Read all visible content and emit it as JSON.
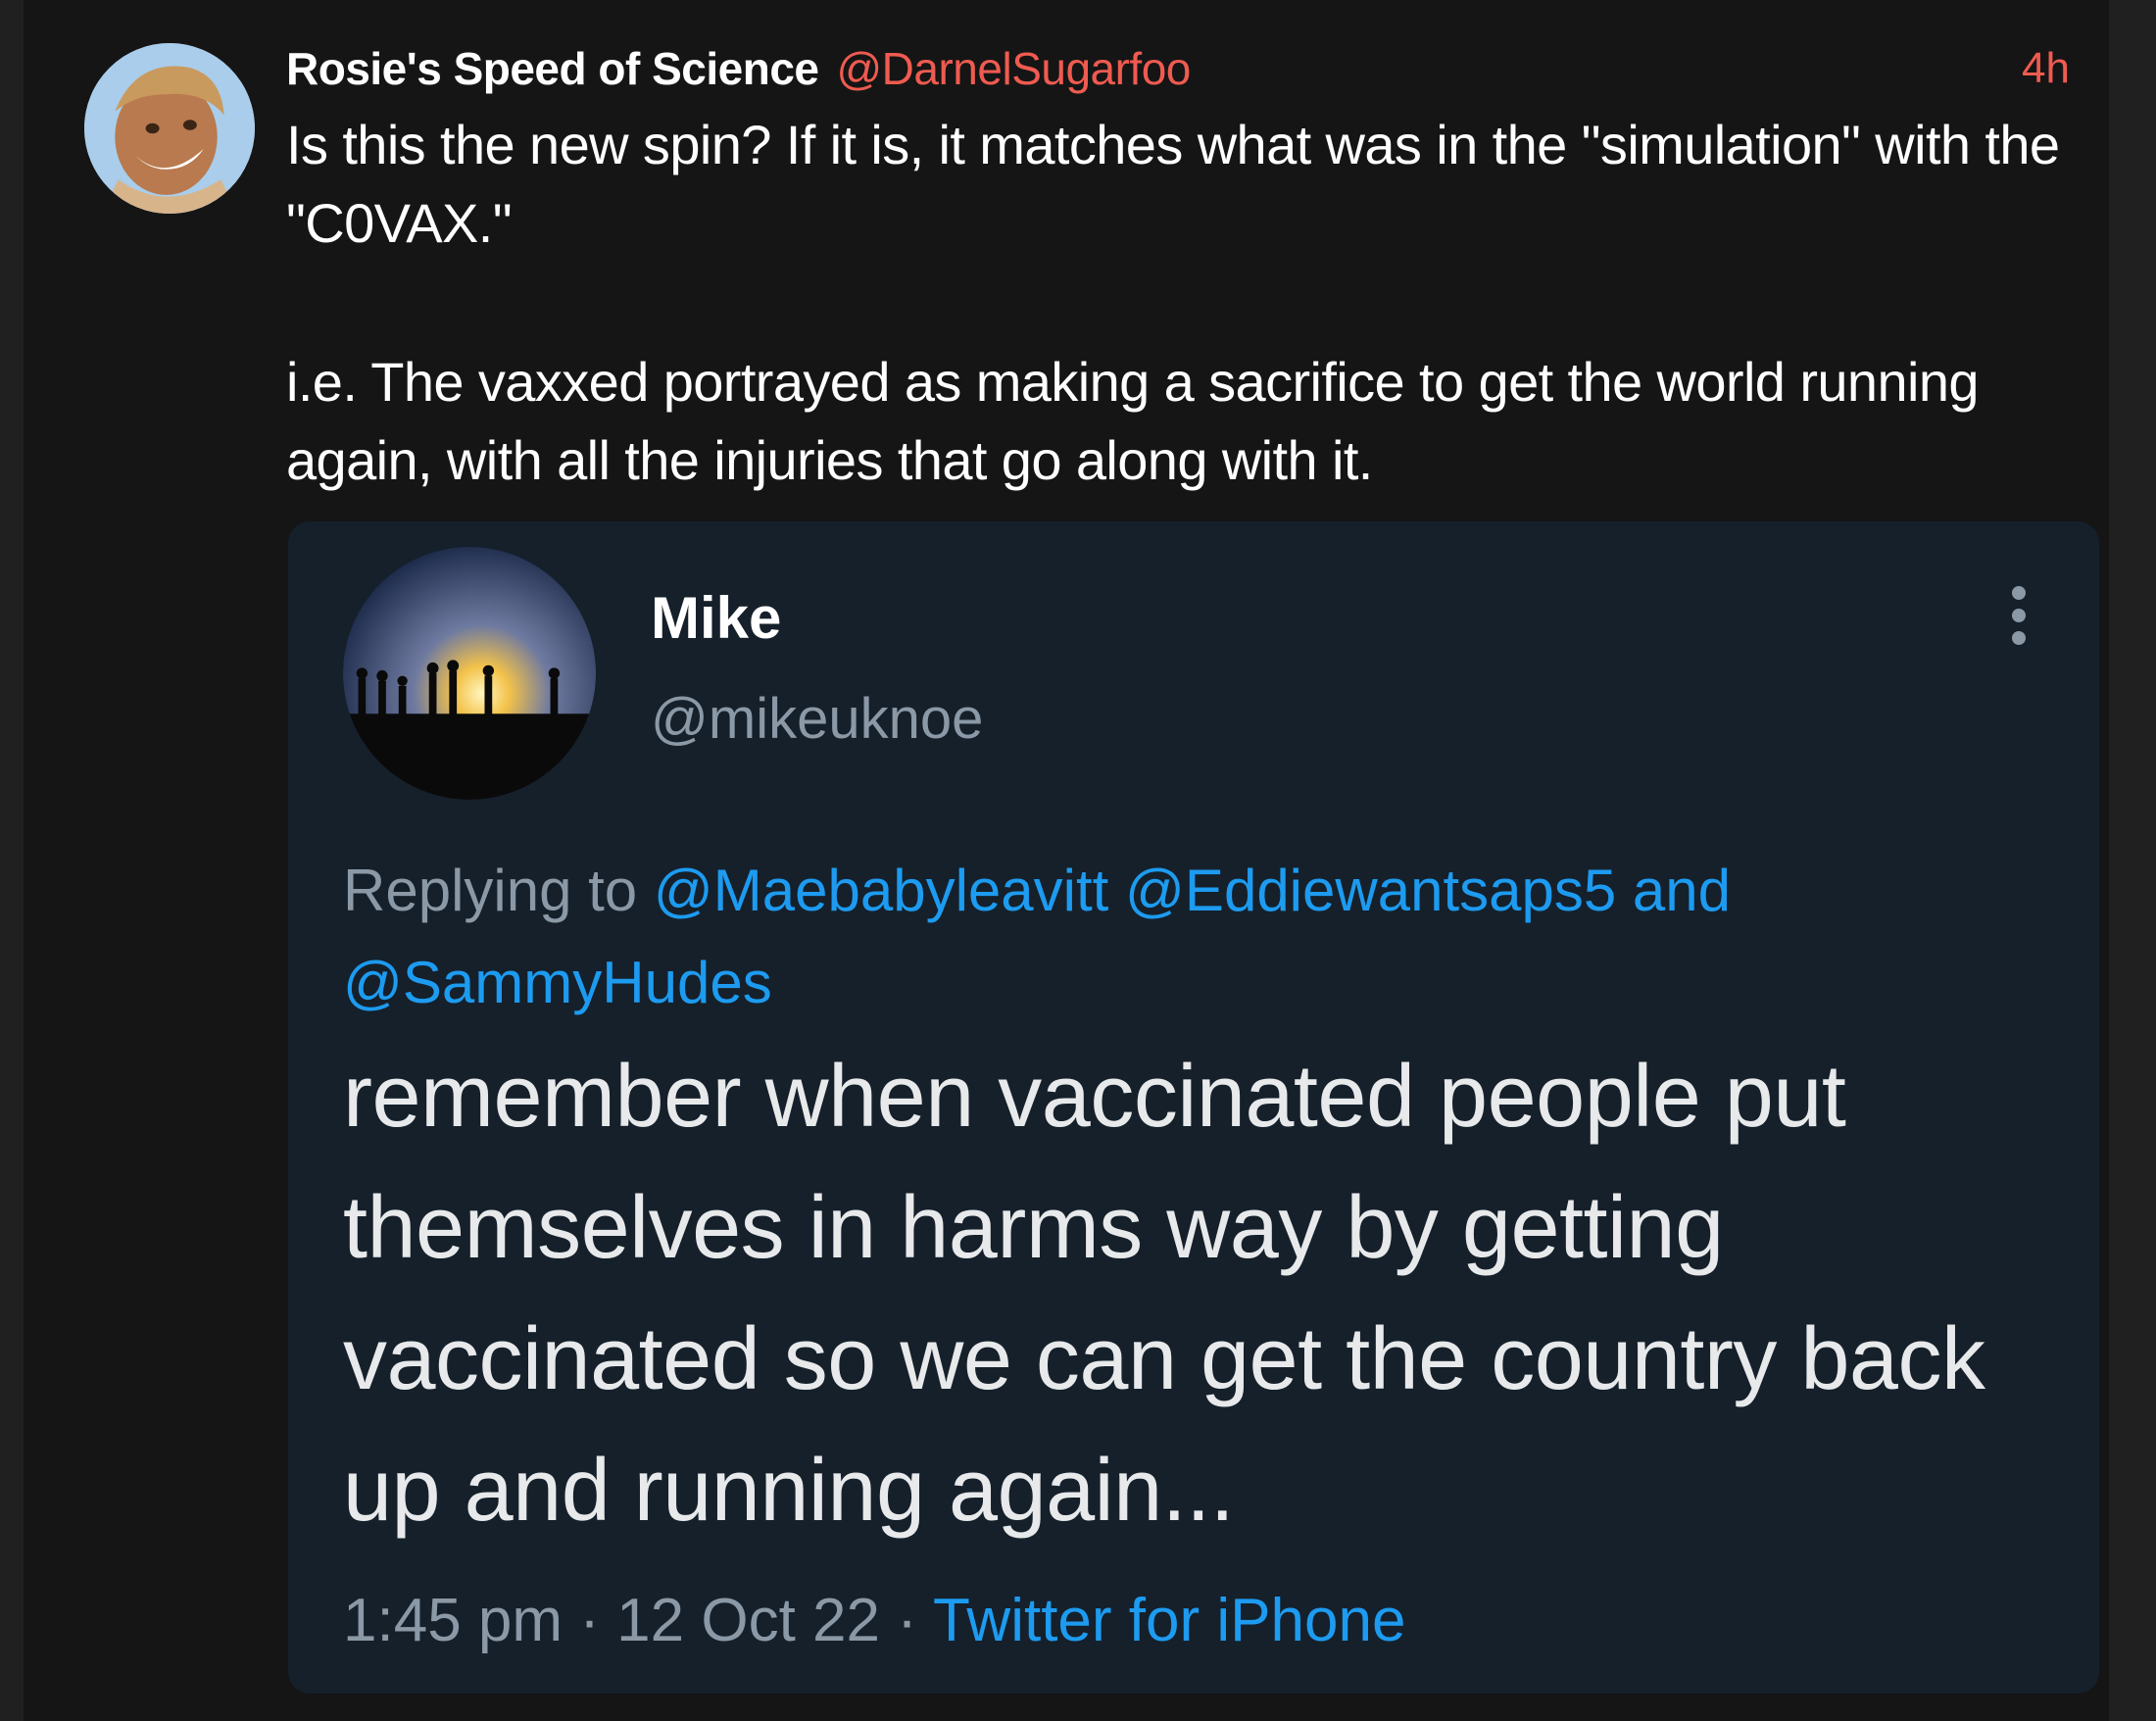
{
  "post": {
    "display_name": "Rosie's Speed of Science",
    "handle": "@DarnelSugarfoo",
    "time": "4h",
    "paragraphs": [
      "Is this the new spin? If it is, it matches what was in the \"simulation\" with the \"C0VAX.\"",
      "i.e. The vaxxed portrayed as making a sacrifice to get the world running again, with all the injuries that go along with it."
    ]
  },
  "quoted": {
    "display_name": "Mike",
    "handle": "@mikeuknoe",
    "replying_prefix": "Replying to",
    "mention_1": "@Maebabyleavitt",
    "mention_2": "@Eddiewantsaps5",
    "conjunction": "and",
    "mention_3": "@SammyHudes",
    "text": "remember when vaccinated people put themselves in harms way by getting vaccinated so we can get the country back up and running again...",
    "time": "1:45 pm",
    "separator": "·",
    "date": "12 Oct 22",
    "source": "Twitter for iPhone"
  },
  "icons": {
    "more": "more-vertical-icon"
  },
  "colors": {
    "background": "#151515",
    "handle_accent": "#ef5b50",
    "quote_background": "#15202b",
    "link_blue": "#1d9bf0",
    "muted_gray": "#8b98a5"
  }
}
